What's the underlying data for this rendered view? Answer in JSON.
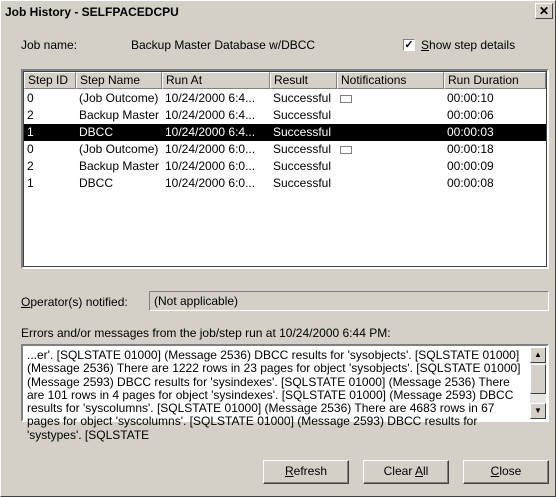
{
  "window": {
    "title": "Job History - SELFPACEDCPU"
  },
  "job": {
    "name_label": "Job name:",
    "name_value": "Backup Master Database w/DBCC"
  },
  "show_step_details": {
    "label": "Show step details",
    "checked": true
  },
  "table": {
    "columns": [
      "Step ID",
      "Step Name",
      "Run At",
      "Result",
      "Notifications",
      "Run Duration"
    ],
    "rows": [
      {
        "step_id": "0",
        "step_name": "(Job Outcome)",
        "run_at": "10/24/2000  6:4...",
        "result": "Successful",
        "notification_icon": "mail-icon",
        "duration": "00:00:10"
      },
      {
        "step_id": "2",
        "step_name": "Backup Master",
        "run_at": "10/24/2000  6:4...",
        "result": "Successful",
        "notification_icon": "",
        "duration": "00:00:06"
      },
      {
        "step_id": "1",
        "step_name": "DBCC",
        "run_at": "10/24/2000  6:4...",
        "result": "Successful",
        "notification_icon": "",
        "duration": "00:00:03",
        "selected": true
      },
      {
        "step_id": "0",
        "step_name": "(Job Outcome)",
        "run_at": "10/24/2000  6:0...",
        "result": "Successful",
        "notification_icon": "mail-icon",
        "duration": "00:00:18"
      },
      {
        "step_id": "2",
        "step_name": "Backup Master",
        "run_at": "10/24/2000  6:0...",
        "result": "Successful",
        "notification_icon": "",
        "duration": "00:00:09"
      },
      {
        "step_id": "1",
        "step_name": "DBCC",
        "run_at": "10/24/2000  6:0...",
        "result": "Successful",
        "notification_icon": "",
        "duration": "00:00:08"
      }
    ]
  },
  "operators": {
    "label": "Operator(s) notified:",
    "value": "(Not applicable)"
  },
  "messages": {
    "label": "Errors and/or messages from the job/step run at 10/24/2000  6:44 PM:",
    "text": "...er'. [SQLSTATE 01000] (Message 2536)  DBCC results for 'sysobjects'. [SQLSTATE 01000] (Message 2536)  There are 1222 rows in 23 pages for object 'sysobjects'. [SQLSTATE 01000] (Message 2593)  DBCC results for 'sysindexes'. [SQLSTATE 01000] (Message 2536)  There are 101 rows in 4 pages for object 'sysindexes'. [SQLSTATE 01000] (Message 2593)  DBCC results for 'syscolumns'. [SQLSTATE 01000] (Message 2536)  There are 4683 rows in 67 pages for object 'syscolumns'. [SQLSTATE 01000] (Message 2593)  DBCC results for 'systypes'. [SQLSTATE"
  },
  "buttons": {
    "refresh": "Refresh",
    "clear_all": "Clear All",
    "close": "Close"
  },
  "colors": {
    "face": "#d4d0c8",
    "selection": "#000000"
  }
}
